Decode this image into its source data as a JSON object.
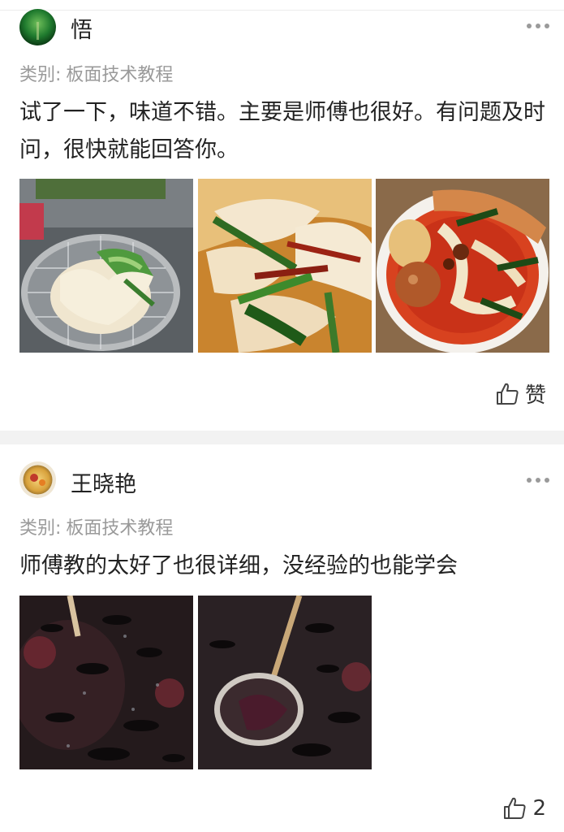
{
  "reviews": [
    {
      "username": "悟",
      "category_label": "类别:",
      "category_value": "板面技术教程",
      "content": "试了一下，味道不错。主要是师傅也很好。有问题及时问，很快就能回答你。",
      "like_text": "赞",
      "avatar_icon": "green-landscape-avatar",
      "photos": [
        "noodles-in-strainer-photo",
        "noodles-with-chili-photo",
        "noodle-bowl-with-sausage-photo"
      ]
    },
    {
      "username": "王晓艳",
      "category_label": "类别:",
      "category_value": "板面技术教程",
      "content": "师傅教的太好了也很详细，没经验的也能学会",
      "like_text": "2",
      "avatar_icon": "flower-avatar",
      "photos": [
        "dark-broth-photo",
        "dark-broth-ladle-photo"
      ]
    }
  ],
  "icons": {
    "more": "more-dots-icon",
    "like": "thumbs-up-icon"
  }
}
